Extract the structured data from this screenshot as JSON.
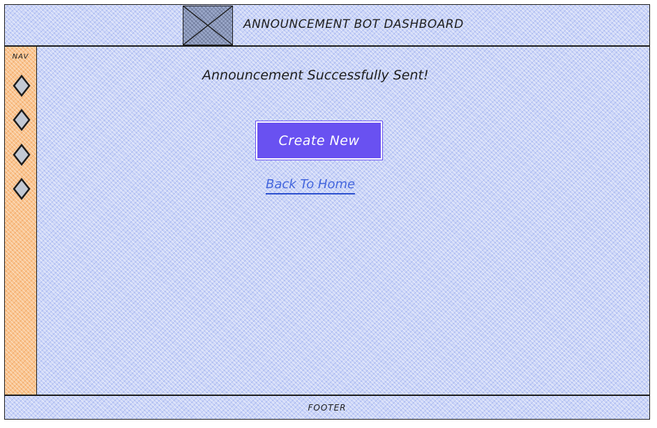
{
  "header": {
    "title": "ANNOUNCEMENT BOT DASHBOARD",
    "logo_icon": "image-placeholder-icon"
  },
  "sidebar": {
    "label": "NAV",
    "items": [
      {
        "icon": "diamond-icon"
      },
      {
        "icon": "diamond-icon"
      },
      {
        "icon": "diamond-icon"
      },
      {
        "icon": "diamond-icon"
      }
    ]
  },
  "main": {
    "status_message": "Announcement Successfully Sent!",
    "create_new_label": "Create New",
    "back_home_label": "Back To Home"
  },
  "footer": {
    "text": "FOOTER"
  },
  "colors": {
    "background": "#c9d3f7",
    "sidebar": "#f9c48f",
    "primary_button": "#6951f1",
    "link": "#4466dd"
  }
}
